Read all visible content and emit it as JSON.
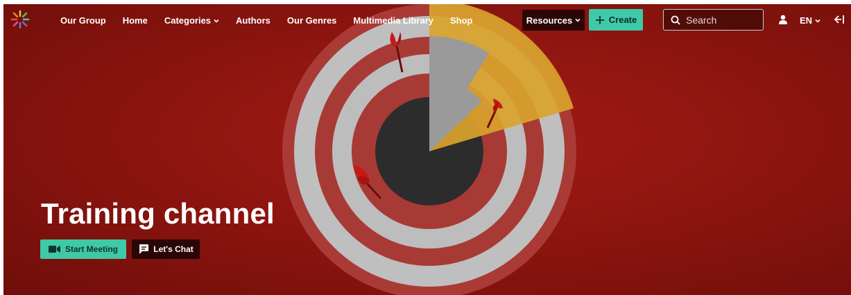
{
  "nav": {
    "items": [
      {
        "label": "Our Group",
        "dropdown": false
      },
      {
        "label": "Home",
        "dropdown": false
      },
      {
        "label": "Categories",
        "dropdown": true
      },
      {
        "label": "Authors",
        "dropdown": false
      },
      {
        "label": "Our Genres",
        "dropdown": false
      },
      {
        "label": "Multimedia Library",
        "dropdown": false
      },
      {
        "label": "Shop",
        "dropdown": false
      }
    ],
    "resources_label": "Resources",
    "create_label": "Create",
    "search_placeholder": "Search",
    "language": "EN"
  },
  "hero": {
    "title": "Training channel",
    "start_meeting_label": "Start Meeting",
    "chat_label": "Let's Chat"
  },
  "icons": {
    "logo": "starburst-logo",
    "user": "user-icon",
    "logout": "logout-icon",
    "search": "search-icon",
    "create": "plus-icon",
    "meeting": "video-camera-icon",
    "chat": "chat-bubble-icon"
  },
  "colors": {
    "accent": "#3ec9a7",
    "dark_button": "#2a0605",
    "hero_background": "#8e1510",
    "target_yellow": "#d9a32c"
  }
}
